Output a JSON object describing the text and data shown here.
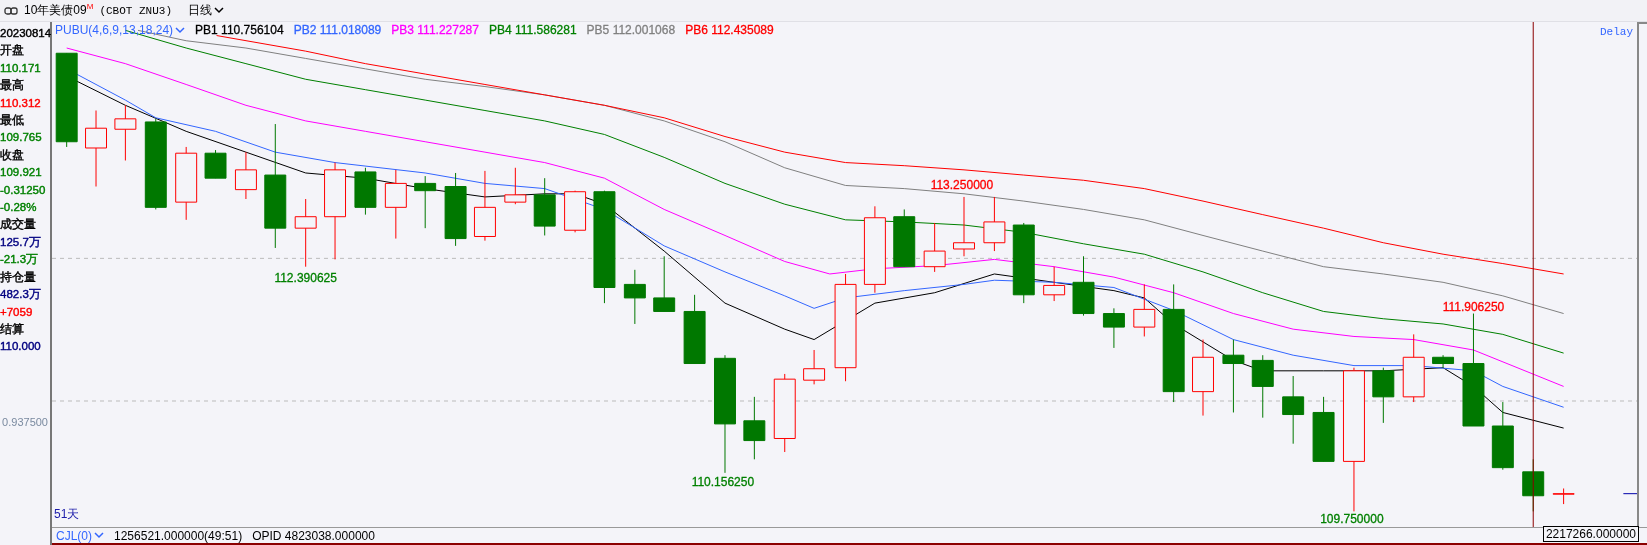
{
  "header": {
    "title": "10年美债09",
    "title_mark": "M",
    "code": "(CBOT ZNU3)",
    "period": "日线"
  },
  "quote_panel": {
    "date": "20230814",
    "lines": [
      {
        "text": "开盘",
        "color": "#000000"
      },
      {
        "text": "110.171",
        "color": "#008000"
      },
      {
        "text": "最高",
        "color": "#000000"
      },
      {
        "text": "110.312",
        "color": "#ff0000"
      },
      {
        "text": "最低",
        "color": "#000000"
      },
      {
        "text": "109.765",
        "color": "#008000"
      },
      {
        "text": "收盘",
        "color": "#000000"
      },
      {
        "text": "109.921",
        "color": "#008000"
      },
      {
        "text": "-0.31250",
        "color": "#008000"
      },
      {
        "text": "-0.28%",
        "color": "#008000"
      },
      {
        "text": "成交量",
        "color": "#000000"
      },
      {
        "text": "125.7万",
        "color": "#000080"
      },
      {
        "text": "-21.3万",
        "color": "#008000"
      },
      {
        "text": "持仓量",
        "color": "#000000"
      },
      {
        "text": "482.3万",
        "color": "#000080"
      },
      {
        "text": "+7059",
        "color": "#ff0000"
      },
      {
        "text": "结算",
        "color": "#000000"
      },
      {
        "text": "110.000",
        "color": "#000080"
      }
    ],
    "axis_label": "0.937500"
  },
  "chart": {
    "indicator": "PUBU(4,6,9,13,18,24)",
    "legend": [
      {
        "name": "PB1",
        "value": "110.756104",
        "color": "#000000"
      },
      {
        "name": "PB2",
        "value": "111.018089",
        "color": "#3366ff"
      },
      {
        "name": "PB3",
        "value": "111.227287",
        "color": "#ff00ff"
      },
      {
        "name": "PB4",
        "value": "111.586281",
        "color": "#008000"
      },
      {
        "name": "PB5",
        "value": "112.001068",
        "color": "#808080"
      },
      {
        "name": "PB6",
        "value": "112.435089",
        "color": "#ff0000"
      }
    ],
    "delay": "Delay",
    "annotations": [
      {
        "text": "113.250000",
        "color": "#ff0000"
      },
      {
        "text": "112.390625",
        "color": "#008000"
      },
      {
        "text": "110.156250",
        "color": "#008000"
      },
      {
        "text": "109.750000",
        "color": "#008000"
      },
      {
        "text": "111.906250",
        "color": "#ff0000"
      }
    ],
    "days": "51天"
  },
  "volume_bar": {
    "indicator": "CJL(0)",
    "reading": "1256521.000000(49:51)",
    "opid": "OPID 4823038.000000",
    "cursor_value": "2217266.000000"
  }
}
